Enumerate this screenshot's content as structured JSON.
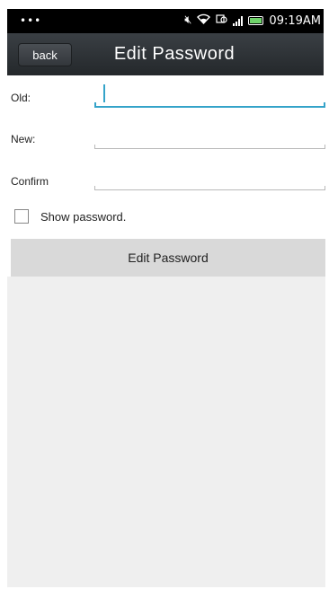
{
  "status_bar": {
    "left": "•••",
    "time": "09:19AM",
    "icons": [
      "mute-icon",
      "wifi-icon",
      "sync-icon",
      "signal-icon",
      "battery-icon"
    ]
  },
  "header": {
    "back_label": "back",
    "title": "Edit Password"
  },
  "form": {
    "old_label": "Old:",
    "old_value": "",
    "new_label": "New:",
    "new_value": "",
    "confirm_label": "Confirm",
    "confirm_value": "",
    "show_password_label": "Show password.",
    "show_password_checked": false,
    "submit_label": "Edit Password"
  },
  "colors": {
    "accent": "#34a3c9",
    "header_bg": "#2e3236",
    "button_bg": "#d9d9d9",
    "content_bg": "#efefef"
  }
}
